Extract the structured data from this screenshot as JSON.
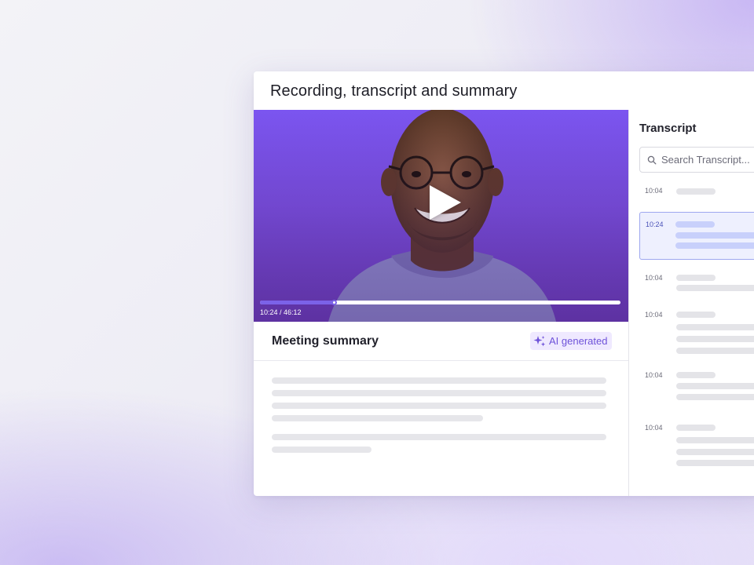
{
  "card": {
    "title": "Recording, transcript and summary"
  },
  "video": {
    "current_time": "10:24",
    "duration": "46:12",
    "timecode": "10:24 / 46:12",
    "progress_fraction": 0.205
  },
  "summary": {
    "title": "Meeting summary",
    "badge_label": "AI generated"
  },
  "transcript": {
    "title": "Transcript",
    "search_placeholder": "Search Transcript...",
    "entries": [
      {
        "time": "10:04",
        "active": false
      },
      {
        "time": "10:24",
        "active": true
      },
      {
        "time": "10:04",
        "active": false
      },
      {
        "time": "10:04",
        "active": false
      },
      {
        "time": "10:04",
        "active": false
      },
      {
        "time": "10:04",
        "active": false
      }
    ]
  },
  "colors": {
    "accent": "#7b62e8",
    "video_bg": "#7b55f0",
    "badge_bg": "#efe9ff",
    "active_row_bg": "#eef0fe"
  }
}
